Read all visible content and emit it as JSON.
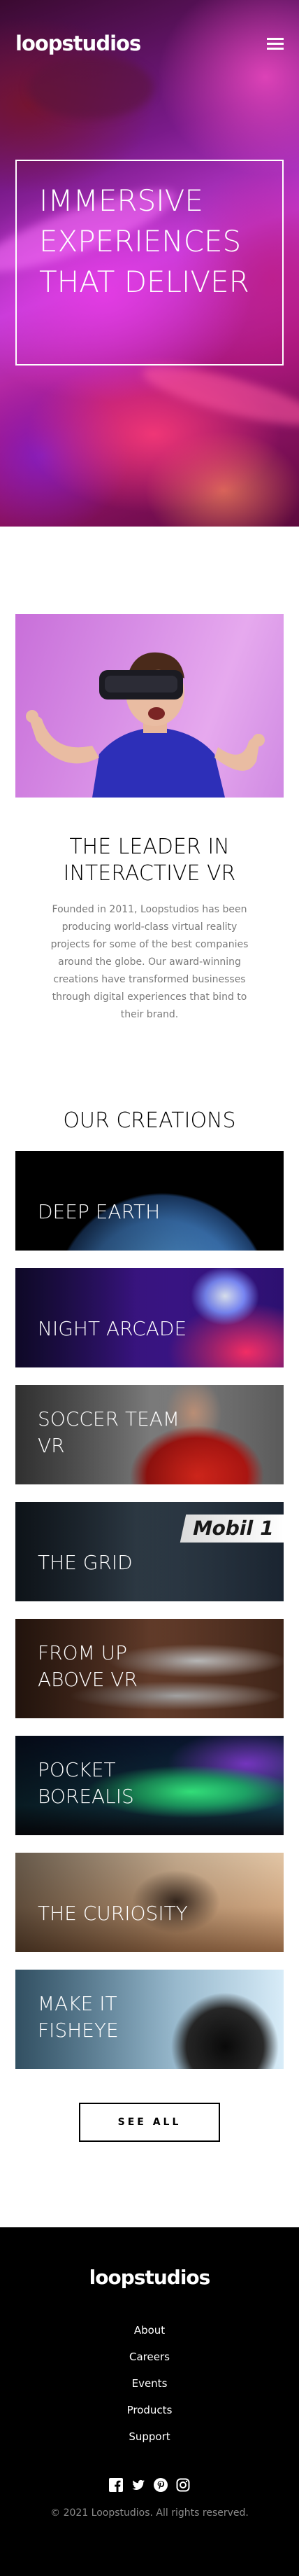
{
  "header": {
    "logo": "loopstudios",
    "menu_icon": "hamburger-menu-icon"
  },
  "hero": {
    "title": "Immersive experiences that deliver"
  },
  "leader": {
    "image_alt": "Man wearing VR headset",
    "heading": "The leader in interactive VR",
    "text": "Founded in 2011, Loopstudios has been producing world-class virtual reality projects for some of the best companies around the globe. Our award-winning creations have transformed businesses through digital experiences that bind to their brand."
  },
  "creations": {
    "heading": "Our creations",
    "items": [
      {
        "label": "Deep Earth"
      },
      {
        "label": "Night Arcade"
      },
      {
        "label": "Soccer Team VR"
      },
      {
        "label": "The Grid"
      },
      {
        "label": "From up above VR"
      },
      {
        "label": "Pocket Borealis"
      },
      {
        "label": "The Curiosity"
      },
      {
        "label": "Make it fisheye"
      }
    ],
    "see_all": "See all"
  },
  "footer": {
    "logo": "loopstudios",
    "links": [
      "About",
      "Careers",
      "Events",
      "Products",
      "Support"
    ],
    "social_icons": [
      "facebook-icon",
      "twitter-icon",
      "pinterest-icon",
      "instagram-icon"
    ],
    "copyright": "© 2021 Loopstudios. All rights reserved."
  },
  "colors": {
    "text_dark": "#000000",
    "text_muted": "#7a7a7a",
    "footer_bg": "#000000",
    "footer_muted": "#8a8a8a"
  }
}
